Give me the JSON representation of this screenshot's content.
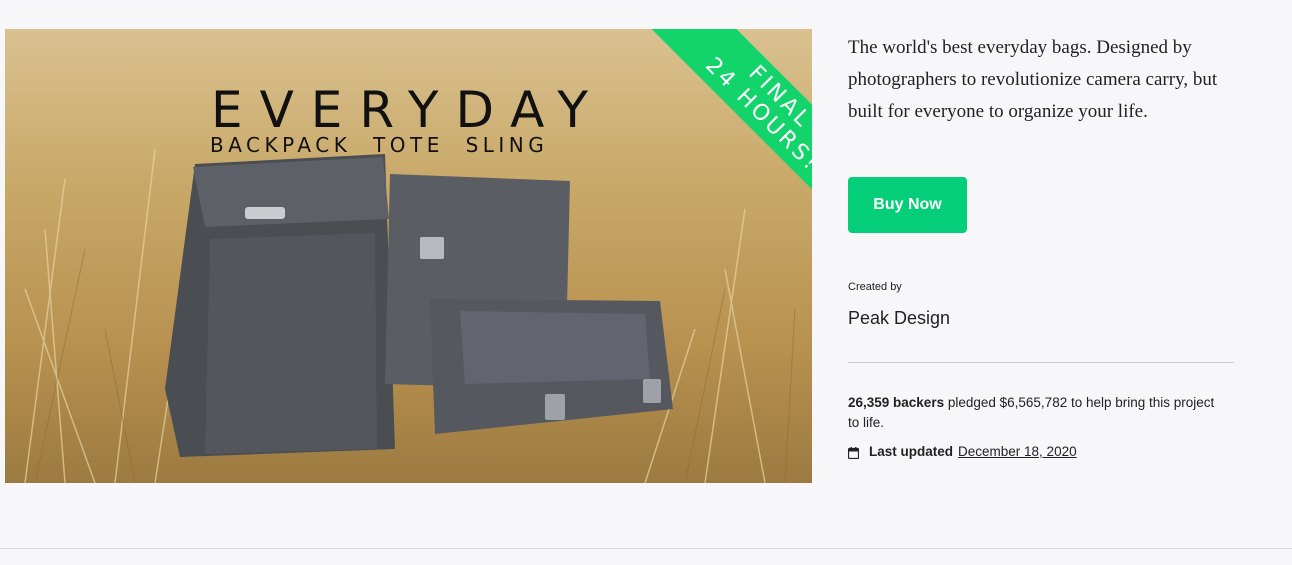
{
  "hero": {
    "title": "EVERYDAY",
    "subtitle": "BACKPACK  TOTE  SLING",
    "ribbon_line1": "FINAL",
    "ribbon_line2": "24 HOURS!",
    "colors": {
      "ribbon": "#13d46b"
    }
  },
  "project": {
    "blurb": "The world's best everyday bags. Designed by photographers to revolutionize camera carry, but built for everyone to organize your life.",
    "buy_label": "Buy Now",
    "created_by_label": "Created by",
    "creator": "Peak Design",
    "backers": "26,359 backers",
    "pledged_text": " pledged $6,565,782 to help bring this project to life.",
    "last_updated_label": "Last updated",
    "last_updated_date": "December 18, 2020"
  },
  "colors": {
    "accent": "#05ce78",
    "background": "#f7f7f9"
  },
  "icons": {
    "calendar": "calendar-icon"
  }
}
